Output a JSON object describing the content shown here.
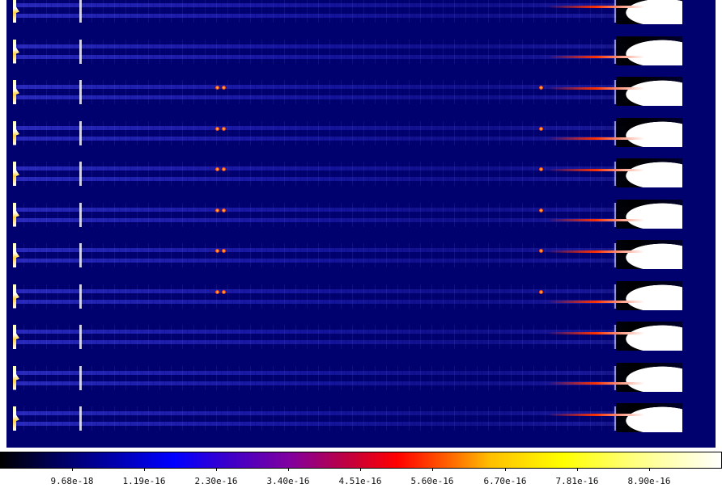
{
  "colorbar": {
    "ticks": [
      "9.68e-18",
      "1.19e-16",
      "2.30e-16",
      "3.40e-16",
      "4.51e-16",
      "5.60e-16",
      "6.70e-16",
      "7.81e-16",
      "8.90e-16"
    ],
    "colormap": [
      "#000000",
      "#0000ff",
      "#8000a0",
      "#ff0000",
      "#ffc000",
      "#ffff00",
      "#ffffff"
    ]
  },
  "image": {
    "background_color": "#00006e",
    "order_count": 11
  }
}
